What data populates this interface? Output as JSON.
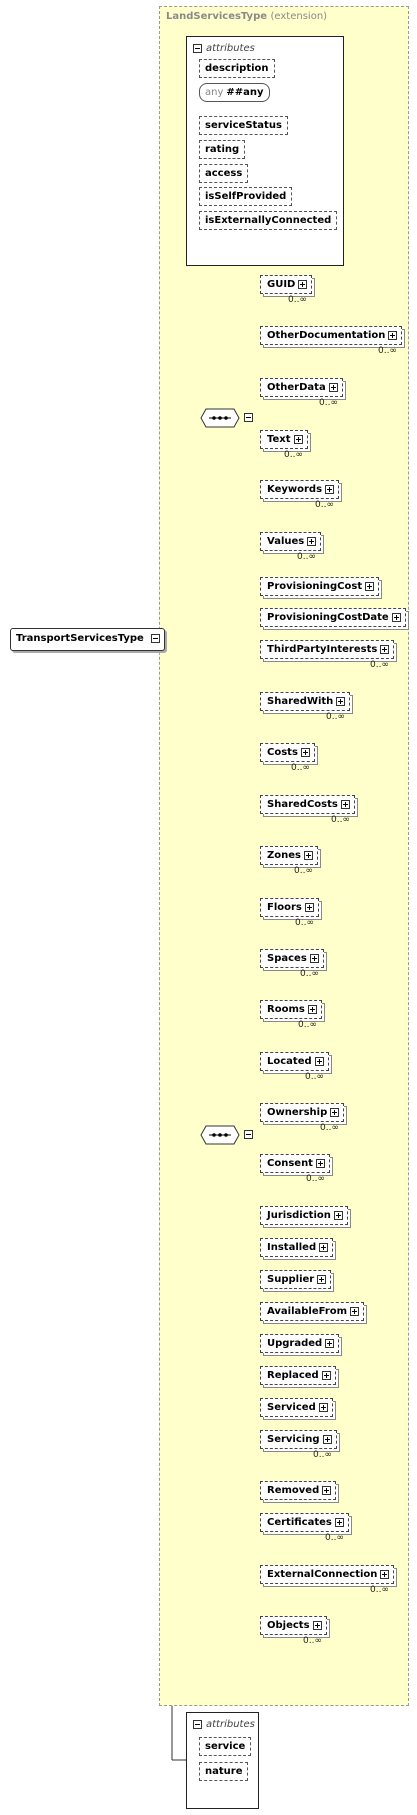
{
  "root": {
    "name": "TransportServicesType"
  },
  "extension": {
    "base": "LandServicesType",
    "suffix": "(extension)"
  },
  "attributes_label": "attributes",
  "ext_attributes": [
    "description",
    "serviceStatus",
    "rating",
    "access",
    "isSelfProvided",
    "isExternallyConnected"
  ],
  "any_attr": {
    "label": "any",
    "value": "##any"
  },
  "group1": [
    {
      "name": "GUID",
      "card": "0..∞"
    },
    {
      "name": "OtherDocumentation",
      "card": "0..∞"
    },
    {
      "name": "OtherData",
      "card": "0..∞"
    },
    {
      "name": "Text",
      "card": "0..∞"
    },
    {
      "name": "Keywords",
      "card": "0..∞"
    },
    {
      "name": "Values",
      "card": "0..∞"
    }
  ],
  "group2": [
    {
      "name": "ProvisioningCost",
      "card": ""
    },
    {
      "name": "ProvisioningCostDate",
      "card": ""
    },
    {
      "name": "ThirdPartyInterests",
      "card": "0..∞"
    },
    {
      "name": "SharedWith",
      "card": "0..∞"
    },
    {
      "name": "Costs",
      "card": "0..∞"
    },
    {
      "name": "SharedCosts",
      "card": "0..∞"
    },
    {
      "name": "Zones",
      "card": "0..∞"
    },
    {
      "name": "Floors",
      "card": "0..∞"
    },
    {
      "name": "Spaces",
      "card": "0..∞"
    },
    {
      "name": "Rooms",
      "card": "0..∞"
    },
    {
      "name": "Located",
      "card": "0..∞"
    },
    {
      "name": "Ownership",
      "card": "0..∞"
    },
    {
      "name": "Consent",
      "card": "0..∞"
    },
    {
      "name": "Jurisdiction",
      "card": ""
    },
    {
      "name": "Installed",
      "card": ""
    },
    {
      "name": "Supplier",
      "card": ""
    },
    {
      "name": "AvailableFrom",
      "card": ""
    },
    {
      "name": "Upgraded",
      "card": ""
    },
    {
      "name": "Replaced",
      "card": ""
    },
    {
      "name": "Serviced",
      "card": ""
    },
    {
      "name": "Servicing",
      "card": "0..∞"
    },
    {
      "name": "Removed",
      "card": ""
    },
    {
      "name": "Certificates",
      "card": "0..∞"
    },
    {
      "name": "ExternalConnection",
      "card": "0..∞"
    },
    {
      "name": "Objects",
      "card": "0..∞"
    }
  ],
  "own_attributes": [
    "service",
    "nature"
  ]
}
